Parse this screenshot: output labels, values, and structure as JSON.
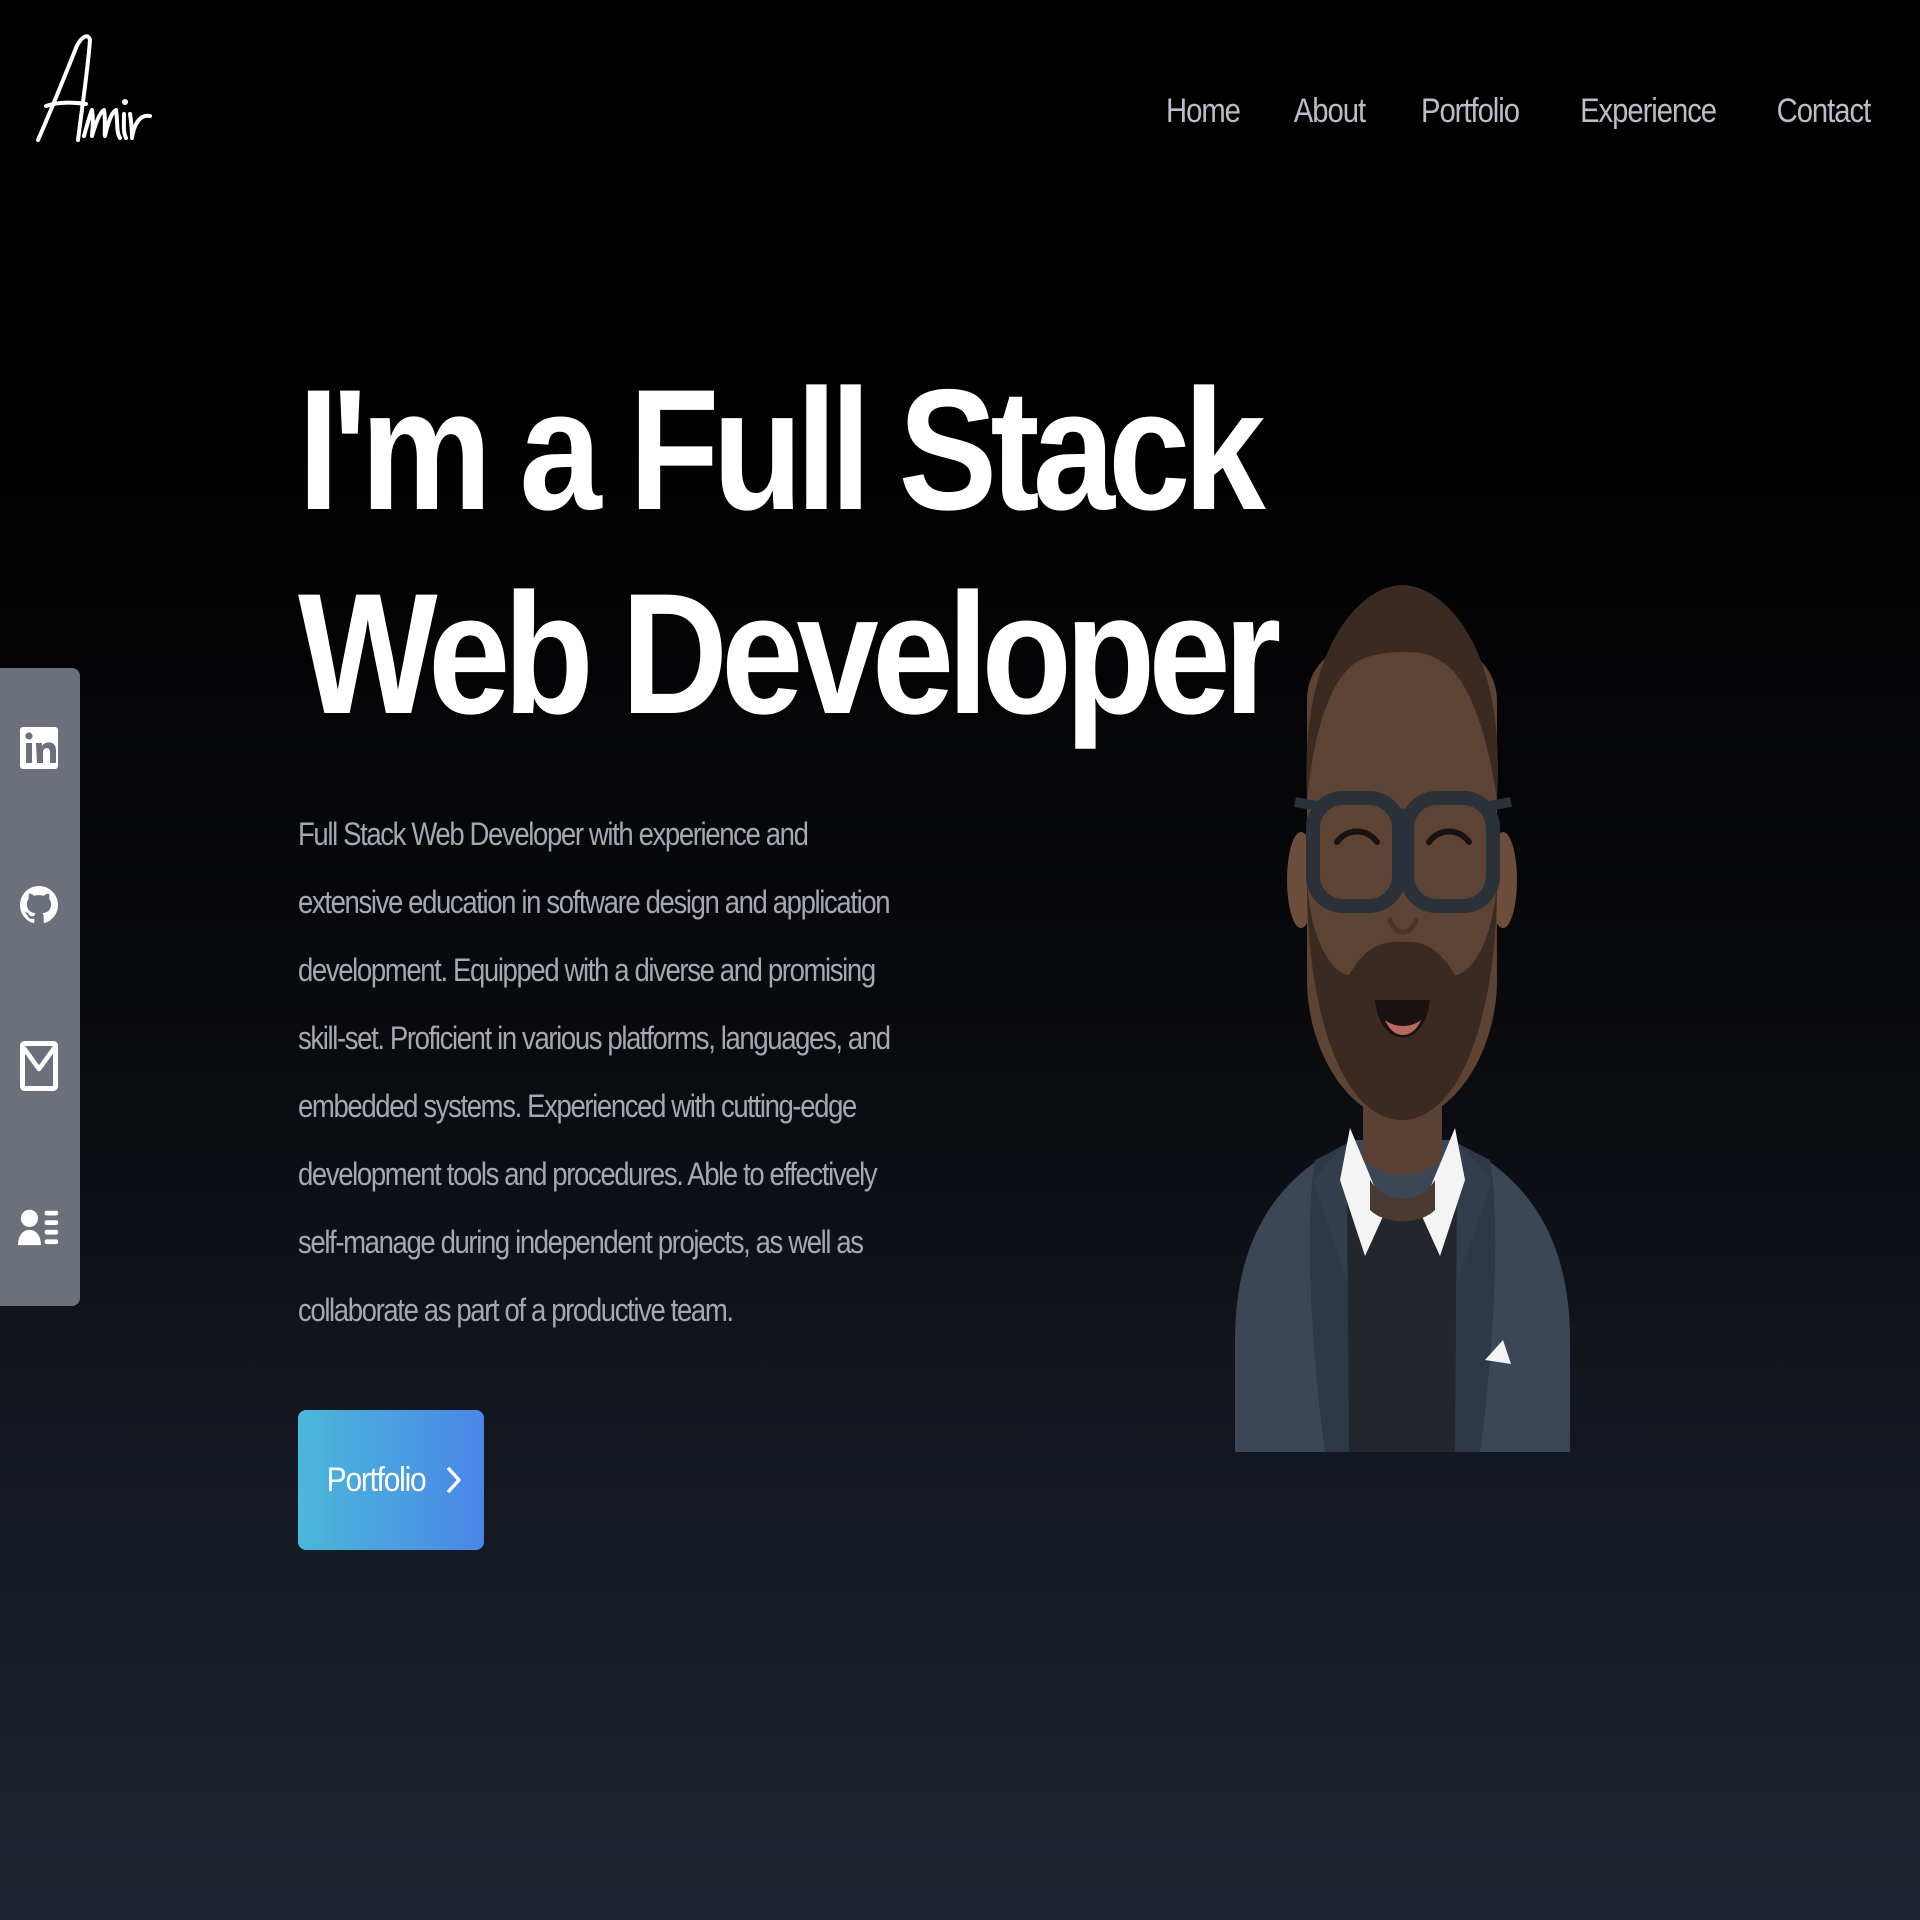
{
  "header": {
    "logo_text": "Amir",
    "nav": [
      {
        "label": "Home"
      },
      {
        "label": "About"
      },
      {
        "label": "Portfolio"
      },
      {
        "label": "Experience"
      },
      {
        "label": "Contact"
      }
    ]
  },
  "hero": {
    "title_line1": "I'm a Full Stack",
    "title_line2": "Web Developer",
    "description": "Full Stack Web Developer with experience and extensive education in software design and application development. Equipped with a diverse and promising skill-set. Proficient in various platforms, languages, and embedded systems. Experienced with cutting-edge development tools and procedures. Able to effectively self-manage during independent projects, as well as collaborate as part of a productive team.",
    "cta_label": "Portfolio",
    "cta_icon": "chevron-right-icon"
  },
  "social": {
    "items": [
      {
        "icon": "linkedin-icon"
      },
      {
        "icon": "github-icon"
      },
      {
        "icon": "mail-icon"
      },
      {
        "icon": "resume-icon"
      }
    ]
  },
  "colors": {
    "background_top": "#000000",
    "background_bottom": "#1f2430",
    "text_primary": "#ffffff",
    "text_muted": "#a4a8b3",
    "sidebar": "#6c707b",
    "cta_gradient_start": "#4ab8d9",
    "cta_gradient_end": "#4a86e8"
  }
}
